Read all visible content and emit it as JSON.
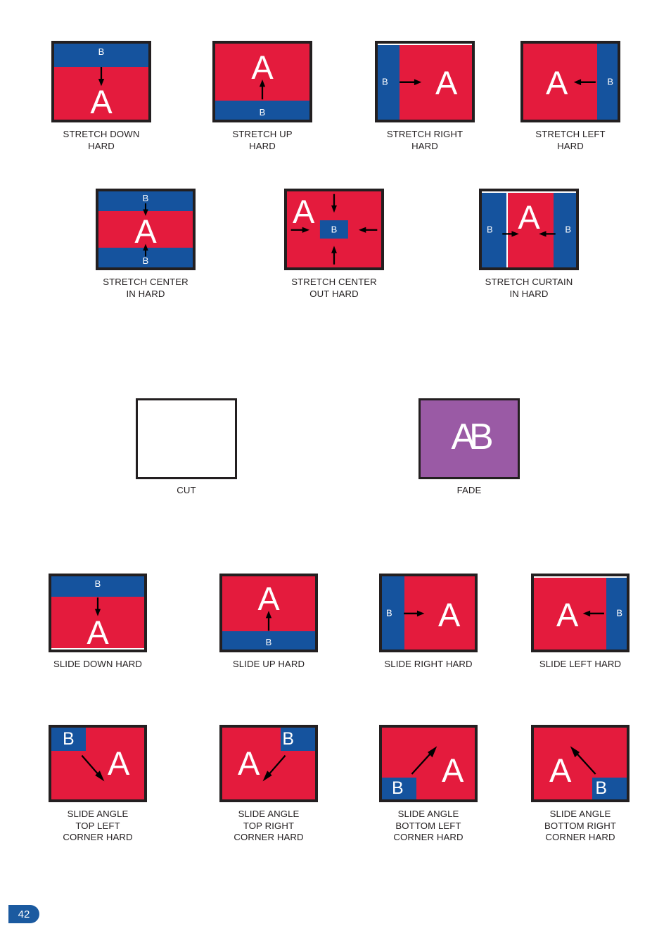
{
  "colors": {
    "red": "#E41B3D",
    "blue": "#15539E",
    "purple": "#9A5AA5",
    "frame": "#231f20",
    "text": "#231f20",
    "badge": "#1B5AA0",
    "white": "#FFFFFF"
  },
  "letters": {
    "a": "A",
    "b": "B",
    "ab": "AB"
  },
  "footer": {
    "page_number": "42"
  },
  "figures": [
    {
      "id": "stretch-down-hard",
      "caption": "STRETCH DOWN\nHARD",
      "a": "A",
      "b": "B",
      "arrow": "down"
    },
    {
      "id": "stretch-up-hard",
      "caption": "STRETCH UP\nHARD",
      "a": "A",
      "b": "B",
      "arrow": "up"
    },
    {
      "id": "stretch-right-hard",
      "caption": "STRETCH RIGHT\nHARD",
      "a": "A",
      "b": "B",
      "arrow": "right"
    },
    {
      "id": "stretch-left-hard",
      "caption": "STRETCH LEFT\nHARD",
      "a": "A",
      "b": "B",
      "arrow": "left"
    },
    {
      "id": "stretch-center-in-hard",
      "caption": "STRETCH CENTER\nIN HARD",
      "a": "A",
      "b_top": "B",
      "b_bottom": "B",
      "arrow": "center-in-vertical"
    },
    {
      "id": "stretch-center-out-hard",
      "caption": "STRETCH CENTER\nOUT HARD",
      "a": "A",
      "b": "B",
      "arrow": "center-in-four"
    },
    {
      "id": "stretch-curtain-in-hard",
      "caption": "STRETCH CURTAIN\nIN HARD",
      "a": "A",
      "b_left": "B",
      "b_right": "B",
      "arrow": "curtain-in"
    },
    {
      "id": "cut",
      "caption": "CUT",
      "arrow": "none"
    },
    {
      "id": "fade",
      "caption": "FADE",
      "ab": "AB",
      "arrow": "none"
    },
    {
      "id": "slide-down-hard",
      "caption": "SLIDE DOWN HARD",
      "a": "A",
      "b": "B",
      "arrow": "down"
    },
    {
      "id": "slide-up-hard",
      "caption": "SLIDE UP HARD",
      "a": "A",
      "b": "B",
      "arrow": "up"
    },
    {
      "id": "slide-right-hard",
      "caption": "SLIDE RIGHT HARD",
      "a": "A",
      "b": "B",
      "arrow": "right"
    },
    {
      "id": "slide-left-hard",
      "caption": "SLIDE LEFT HARD",
      "a": "A",
      "b": "B",
      "arrow": "left"
    },
    {
      "id": "slide-angle-top-left-corner-hard",
      "caption": "SLIDE ANGLE\nTOP LEFT\nCORNER HARD",
      "a": "A",
      "b": "B",
      "arrow": "diagonal-down-right"
    },
    {
      "id": "slide-angle-top-right-corner-hard",
      "caption": "SLIDE ANGLE\nTOP RIGHT\nCORNER HARD",
      "a": "A",
      "b": "B",
      "arrow": "diagonal-down-left"
    },
    {
      "id": "slide-angle-bottom-left-corner-hard",
      "caption": "SLIDE ANGLE\nBOTTOM LEFT\nCORNER HARD",
      "a": "A",
      "b": "B",
      "arrow": "diagonal-up-right"
    },
    {
      "id": "slide-angle-bottom-right-corner-hard",
      "caption": "SLIDE ANGLE\nBOTTOM RIGHT\nCORNER HARD",
      "a": "A",
      "b": "B",
      "arrow": "diagonal-up-left"
    }
  ]
}
